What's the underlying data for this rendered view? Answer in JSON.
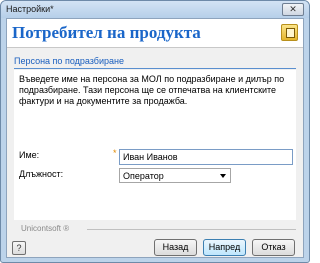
{
  "window": {
    "title": "Настройки*",
    "close_glyph": "✕"
  },
  "header": {
    "title": "Потребител на продукта",
    "icon": "settings-app-icon"
  },
  "section": {
    "link": "Персона по подразбиране",
    "description": "Въведете име на персона за МОЛ по подразбиране и дилър по подразбиране. Тази персона ще се отпечатва на клиентските фактури и на документите за продажба."
  },
  "form": {
    "name_label": "Име:",
    "name_required_mark": "*",
    "name_value": "Иван Иванов",
    "position_label": "Длъжност:",
    "position_value": "Оператор"
  },
  "footer": {
    "brand": "Unicontsoft ®",
    "help_glyph": "?",
    "back_label": "Назад",
    "next_label": "Напред",
    "cancel_label": "Отказ"
  }
}
